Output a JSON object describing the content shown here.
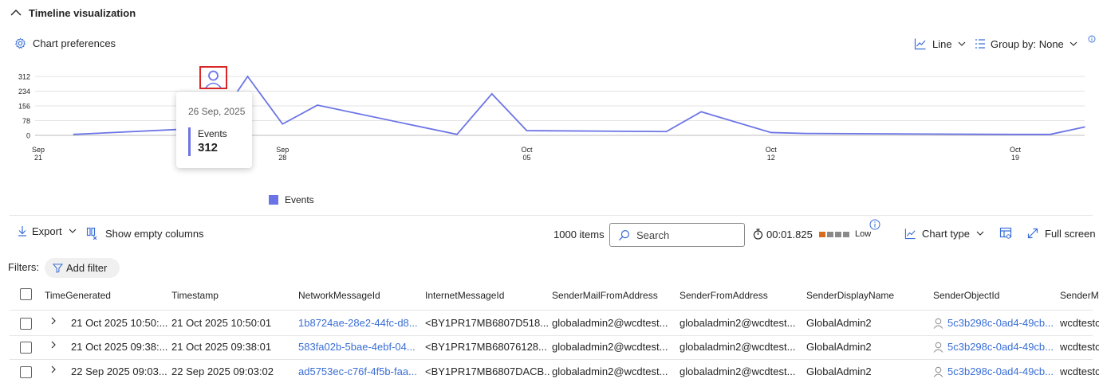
{
  "section": {
    "title": "Timeline visualization",
    "chart_prefs_label": "Chart preferences",
    "line_label": "Line",
    "group_by_label": "Group by: None"
  },
  "chart_data": {
    "type": "line",
    "x": [
      "2025-09-22",
      "2025-09-26",
      "2025-09-27",
      "2025-09-28",
      "2025-09-29",
      "2025-10-03",
      "2025-10-04",
      "2025-10-05",
      "2025-10-09",
      "2025-10-10",
      "2025-10-12",
      "2025-10-13",
      "2025-10-19",
      "2025-10-20",
      "2025-10-21"
    ],
    "series": [
      {
        "name": "Events",
        "values": [
          5,
          40,
          312,
          60,
          160,
          5,
          220,
          25,
          20,
          125,
          15,
          10,
          5,
          5,
          45
        ]
      }
    ],
    "y_ticks": [
      "312",
      "234",
      "156",
      "78",
      "0"
    ],
    "ylim": [
      0,
      312
    ],
    "x_ticks": [
      {
        "month": "Sep",
        "day": "21"
      },
      {
        "month": "Sep",
        "day": "28"
      },
      {
        "month": "Oct",
        "day": "05"
      },
      {
        "month": "Oct",
        "day": "12"
      },
      {
        "month": "Oct",
        "day": "19"
      }
    ],
    "line_color": "#6b74e6",
    "grid": true,
    "legend_label": "Events",
    "legend_position": "bottom-left"
  },
  "tooltip": {
    "date": "26 Sep, 2025",
    "series_label": "Events",
    "value": "312"
  },
  "toolbar": {
    "export_label": "Export",
    "show_empty_label": "Show empty columns",
    "items_count": "1000 items",
    "search_placeholder": "Search",
    "elapsed": "00:01.825",
    "severity_label": "Low",
    "chart_type_label": "Chart type",
    "full_screen_label": "Full screen"
  },
  "filters": {
    "label": "Filters:",
    "add_filter_label": "Add filter"
  },
  "table": {
    "columns": [
      "TimeGenerated",
      "Timestamp",
      "NetworkMessageId",
      "InternetMessageId",
      "SenderMailFromAddress",
      "SenderFromAddress",
      "SenderDisplayName",
      "SenderObjectId",
      "SenderMa"
    ],
    "rows": [
      [
        "21 Oct 2025 10:50:...",
        "21 Oct 2025 10:50:01",
        "1b8724ae-28e2-44fc-d8...",
        "<BY1PR17MB6807D518...",
        "globaladmin2@wcdtest...",
        "globaladmin2@wcdtest...",
        "GlobalAdmin2",
        "5c3b298c-0ad4-49cb...",
        "wcdtestc"
      ],
      [
        "21 Oct 2025 09:38:...",
        "21 Oct 2025 09:38:01",
        "583fa02b-5bae-4ebf-04...",
        "<BY1PR17MB68076128...",
        "globaladmin2@wcdtest...",
        "globaladmin2@wcdtest...",
        "GlobalAdmin2",
        "5c3b298c-0ad4-49cb...",
        "wcdtestc"
      ],
      [
        "22 Sep 2025 09:03...",
        "22 Sep 2025 09:03:02",
        "ad5753ec-c76f-4f5b-faa...",
        "<BY1PR17MB6807DACB...",
        "globaladmin2@wcdtest...",
        "globaladmin2@wcdtest...",
        "GlobalAdmin2",
        "5c3b298c-0ad4-49cb...",
        "wcdtestc"
      ]
    ]
  }
}
